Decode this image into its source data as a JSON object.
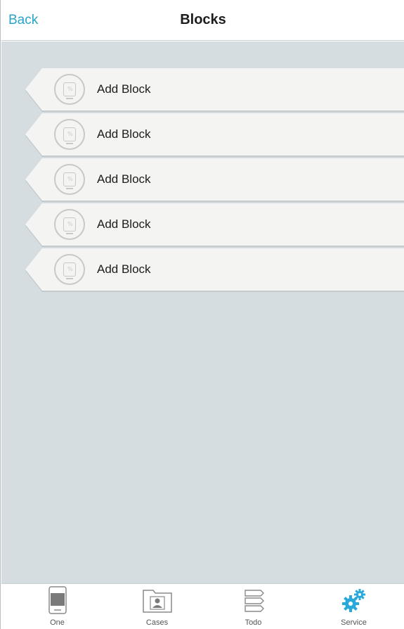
{
  "header": {
    "back_label": "Back",
    "title": "Blocks"
  },
  "blocks": [
    {
      "label": "Add Block",
      "icon": "block-placeholder-icon"
    },
    {
      "label": "Add Block",
      "icon": "block-placeholder-icon"
    },
    {
      "label": "Add Block",
      "icon": "block-placeholder-icon"
    },
    {
      "label": "Add Block",
      "icon": "block-placeholder-icon"
    },
    {
      "label": "Add Block",
      "icon": "block-placeholder-icon"
    }
  ],
  "tabbar": {
    "tabs": [
      {
        "label": "One",
        "icon": "device-icon",
        "active": false
      },
      {
        "label": "Cases",
        "icon": "folder-user-icon",
        "active": false
      },
      {
        "label": "Todo",
        "icon": "todo-list-icon",
        "active": false
      },
      {
        "label": "Service",
        "icon": "gears-icon",
        "active": true
      }
    ]
  },
  "colors": {
    "accent": "#2aa4c8",
    "content_bg": "#d5dde0",
    "block_bg": "#f4f4f3",
    "service_icon": "#29a9d9"
  }
}
